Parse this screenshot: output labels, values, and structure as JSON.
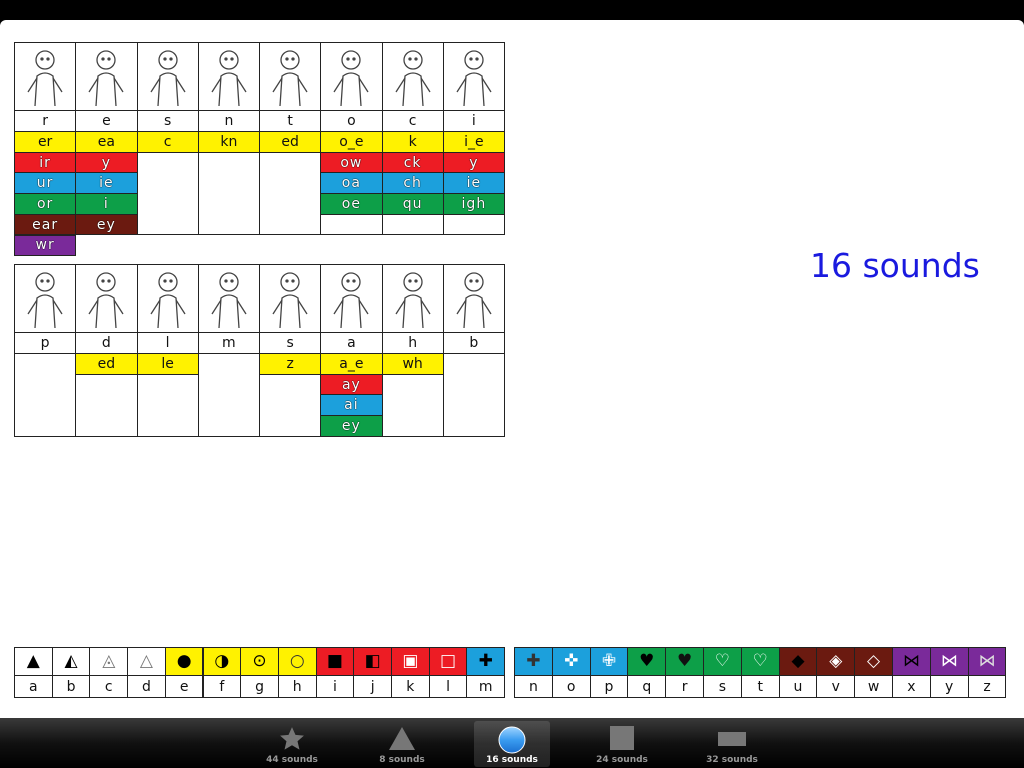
{
  "colors": {
    "Y": "#fff200",
    "R": "#ed1c24",
    "B": "#1ca0dc",
    "G": "#0d9f48",
    "Br": "#6b1a10",
    "P": "#7a2a9a"
  },
  "grid_top": [
    {
      "letter": "r",
      "cells": [
        [
          "er",
          "Y"
        ],
        [
          "ir",
          "R"
        ],
        [
          "ur",
          "B"
        ],
        [
          "or",
          "G"
        ],
        [
          "ear",
          "Br"
        ],
        [
          "wr",
          "P"
        ]
      ]
    },
    {
      "letter": "e",
      "cells": [
        [
          "ea",
          "Y"
        ],
        [
          "y",
          "R"
        ],
        [
          "ie",
          "B"
        ],
        [
          "i",
          "G"
        ],
        [
          "ey",
          "Br"
        ]
      ]
    },
    {
      "letter": "s",
      "cells": [
        [
          "c",
          "Y"
        ]
      ]
    },
    {
      "letter": "n",
      "cells": [
        [
          "kn",
          "Y"
        ]
      ]
    },
    {
      "letter": "t",
      "cells": [
        [
          "ed",
          "Y"
        ]
      ]
    },
    {
      "letter": "o",
      "cells": [
        [
          "o_e",
          "Y"
        ],
        [
          "ow",
          "R"
        ],
        [
          "oa",
          "B"
        ],
        [
          "oe",
          "G"
        ]
      ]
    },
    {
      "letter": "c",
      "cells": [
        [
          "k",
          "Y"
        ],
        [
          "ck",
          "R"
        ],
        [
          "ch",
          "B"
        ],
        [
          "qu",
          "G"
        ]
      ]
    },
    {
      "letter": "i",
      "cells": [
        [
          "i_e",
          "Y"
        ],
        [
          "y",
          "R"
        ],
        [
          "ie",
          "B"
        ],
        [
          "igh",
          "G"
        ]
      ]
    }
  ],
  "grid_bottom": [
    {
      "letter": "p",
      "cells": []
    },
    {
      "letter": "d",
      "cells": [
        [
          "ed",
          "Y"
        ]
      ]
    },
    {
      "letter": "l",
      "cells": [
        [
          "le",
          "Y"
        ]
      ]
    },
    {
      "letter": "m",
      "cells": []
    },
    {
      "letter": "s",
      "cells": [
        [
          "z",
          "Y"
        ]
      ]
    },
    {
      "letter": "a",
      "cells": [
        [
          "a_e",
          "Y"
        ],
        [
          "ay",
          "R"
        ],
        [
          "ai",
          "B"
        ],
        [
          "ey",
          "G"
        ]
      ]
    },
    {
      "letter": "h",
      "cells": [
        [
          "wh",
          "Y"
        ]
      ]
    },
    {
      "letter": "b",
      "cells": []
    }
  ],
  "sounds_label": "16 sounds",
  "shape_strip": [
    {
      "letter": "a",
      "shape": "▲",
      "color": "#fff",
      "ink": "#000"
    },
    {
      "letter": "b",
      "shape": "◭",
      "color": "#fff",
      "ink": "#000"
    },
    {
      "letter": "c",
      "shape": "◬",
      "color": "#fff",
      "ink": "#777"
    },
    {
      "letter": "d",
      "shape": "△",
      "color": "#fff",
      "ink": "#777"
    },
    {
      "letter": "e",
      "shape": "●",
      "color": "Y",
      "ink": "#000"
    },
    {
      "letter": "f",
      "shape": "◑",
      "color": "Y",
      "ink": "#000"
    },
    {
      "letter": "g",
      "shape": "⊙",
      "color": "Y",
      "ink": "#000"
    },
    {
      "letter": "h",
      "shape": "○",
      "color": "Y",
      "ink": "#333"
    },
    {
      "letter": "i",
      "shape": "■",
      "color": "R",
      "ink": "#000"
    },
    {
      "letter": "j",
      "shape": "◧",
      "color": "R",
      "ink": "#000"
    },
    {
      "letter": "k",
      "shape": "▣",
      "color": "R",
      "ink": "#fff"
    },
    {
      "letter": "l",
      "shape": "□",
      "color": "R",
      "ink": "#fff"
    },
    {
      "letter": "m",
      "shape": "✚",
      "color": "B",
      "ink": "#000"
    },
    {
      "letter": "n",
      "shape": "✚",
      "color": "B",
      "ink": "#333"
    },
    {
      "letter": "o",
      "shape": "✜",
      "color": "B",
      "ink": "#fff"
    },
    {
      "letter": "p",
      "shape": "✙",
      "color": "B",
      "ink": "#fff"
    },
    {
      "letter": "q",
      "shape": "♥",
      "color": "G",
      "ink": "#000"
    },
    {
      "letter": "r",
      "shape": "♥",
      "color": "G",
      "ink": "#111"
    },
    {
      "letter": "s",
      "shape": "♡",
      "color": "G",
      "ink": "#fff"
    },
    {
      "letter": "t",
      "shape": "♡",
      "color": "G",
      "ink": "#fff"
    },
    {
      "letter": "u",
      "shape": "◆",
      "color": "Br",
      "ink": "#000"
    },
    {
      "letter": "v",
      "shape": "◈",
      "color": "Br",
      "ink": "#fff"
    },
    {
      "letter": "w",
      "shape": "◇",
      "color": "Br",
      "ink": "#fff"
    },
    {
      "letter": "x",
      "shape": "⋈",
      "color": "P",
      "ink": "#000"
    },
    {
      "letter": "y",
      "shape": "⋈",
      "color": "P",
      "ink": "#fff"
    },
    {
      "letter": "z",
      "shape": "⋈",
      "color": "P",
      "ink": "#ddd"
    }
  ],
  "tabs": [
    {
      "label": "44 sounds",
      "icon": "star-icon",
      "selected": false
    },
    {
      "label": "8 sounds",
      "icon": "triangle-icon",
      "selected": false
    },
    {
      "label": "16 sounds",
      "icon": "circle-icon",
      "selected": true
    },
    {
      "label": "24 sounds",
      "icon": "square-icon",
      "selected": false
    },
    {
      "label": "32 sounds",
      "icon": "rectangle-icon",
      "selected": false
    }
  ]
}
